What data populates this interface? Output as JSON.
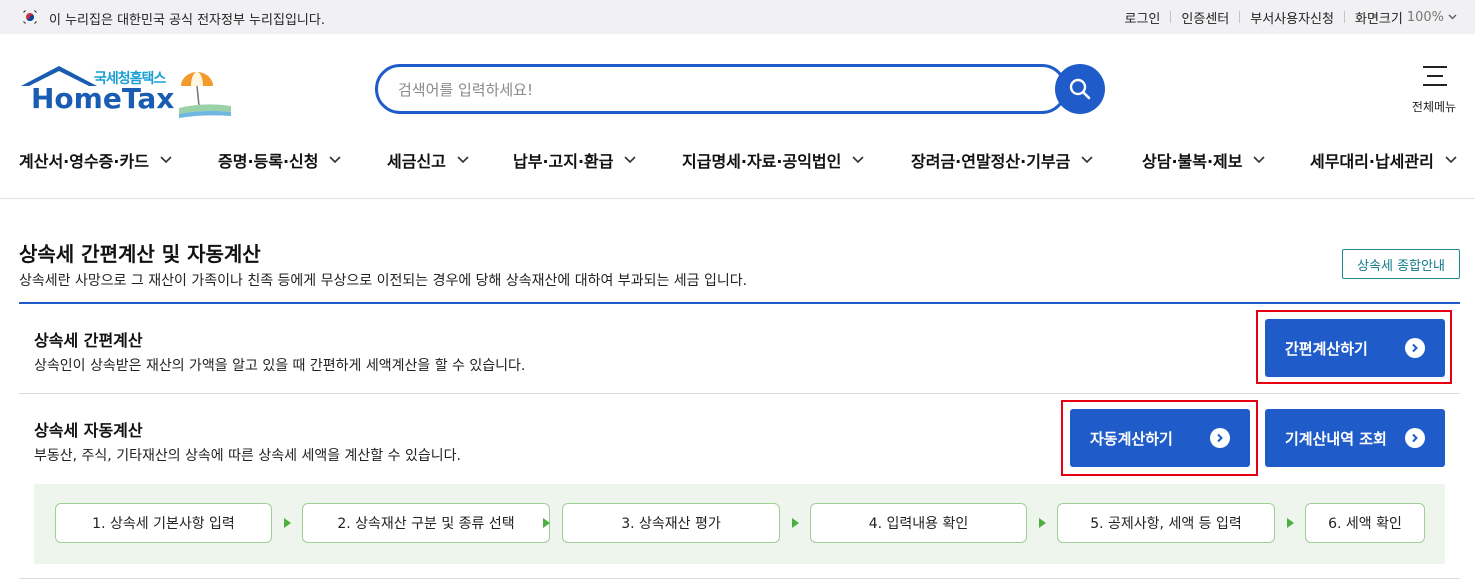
{
  "gov_banner": {
    "text": "이 누리집은 대한민국 공식 전자정부 누리집입니다.",
    "links": [
      "로그인",
      "인증센터",
      "부서사용자신청"
    ],
    "zoom_label": "화면크기",
    "zoom_value": "100%"
  },
  "header": {
    "logo_sub": "국세청홈택스",
    "logo_main": "HomeTax",
    "search_placeholder": "검색어를 입력하세요!",
    "all_menu_label": "전체메뉴"
  },
  "gnb": {
    "items": [
      "계산서·영수증·카드",
      "증명·등록·신청",
      "세금신고",
      "납부·고지·환급",
      "지급명세·자료·공익법인",
      "장려금·연말정산·기부금",
      "상담·불복·제보",
      "세무대리·납세관리"
    ]
  },
  "section": {
    "title": "상속세 간편계산 및 자동계산",
    "description": "상속세란 사망으로 그 재산이 가족이나 친족 등에게 무상으로 이전되는 경우에 당해 상속재산에 대하여 부과되는 세금 입니다.",
    "guide_button": "상속세 종합안내"
  },
  "simple_calc": {
    "title": "상속세 간편계산",
    "description": "상속인이 상속받은 재산의 가액을 알고 있을 때 간편하게 세액계산을 할 수 있습니다.",
    "button": "간편계산하기"
  },
  "auto_calc": {
    "title": "상속세 자동계산",
    "description": "부동산, 주식, 기타재산의 상속에 따른 상속세 세액을 계산할 수 있습니다.",
    "button": "자동계산하기",
    "history_button": "기계산내역 조회",
    "steps": [
      "1. 상속세 기본사항 입력",
      "2. 상속재산 구분 및 종류 선택",
      "3. 상속재산 평가",
      "4. 입력내용 확인",
      "5. 공제사항, 세액 등 입력",
      "6. 세액 확인"
    ]
  },
  "colors": {
    "primary": "#1f5cc9",
    "highlight": "#e60012",
    "step_border": "#9fcf96",
    "step_bg": "#eef5ec",
    "guide_border": "#1d8a9a"
  },
  "icons": [
    "flag-icon",
    "search-icon",
    "hamburger-icon",
    "chevron-down-icon",
    "arrow-right-circle-icon",
    "step-arrow-icon"
  ]
}
